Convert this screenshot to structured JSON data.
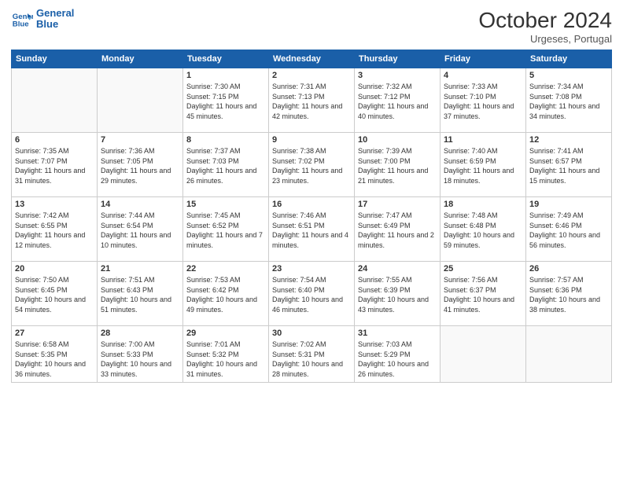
{
  "header": {
    "logo_line1": "General",
    "logo_line2": "Blue",
    "month": "October 2024",
    "location": "Urgeses, Portugal"
  },
  "weekdays": [
    "Sunday",
    "Monday",
    "Tuesday",
    "Wednesday",
    "Thursday",
    "Friday",
    "Saturday"
  ],
  "weeks": [
    [
      {
        "day": "",
        "sunrise": "",
        "sunset": "",
        "daylight": ""
      },
      {
        "day": "",
        "sunrise": "",
        "sunset": "",
        "daylight": ""
      },
      {
        "day": "1",
        "sunrise": "Sunrise: 7:30 AM",
        "sunset": "Sunset: 7:15 PM",
        "daylight": "Daylight: 11 hours and 45 minutes."
      },
      {
        "day": "2",
        "sunrise": "Sunrise: 7:31 AM",
        "sunset": "Sunset: 7:13 PM",
        "daylight": "Daylight: 11 hours and 42 minutes."
      },
      {
        "day": "3",
        "sunrise": "Sunrise: 7:32 AM",
        "sunset": "Sunset: 7:12 PM",
        "daylight": "Daylight: 11 hours and 40 minutes."
      },
      {
        "day": "4",
        "sunrise": "Sunrise: 7:33 AM",
        "sunset": "Sunset: 7:10 PM",
        "daylight": "Daylight: 11 hours and 37 minutes."
      },
      {
        "day": "5",
        "sunrise": "Sunrise: 7:34 AM",
        "sunset": "Sunset: 7:08 PM",
        "daylight": "Daylight: 11 hours and 34 minutes."
      }
    ],
    [
      {
        "day": "6",
        "sunrise": "Sunrise: 7:35 AM",
        "sunset": "Sunset: 7:07 PM",
        "daylight": "Daylight: 11 hours and 31 minutes."
      },
      {
        "day": "7",
        "sunrise": "Sunrise: 7:36 AM",
        "sunset": "Sunset: 7:05 PM",
        "daylight": "Daylight: 11 hours and 29 minutes."
      },
      {
        "day": "8",
        "sunrise": "Sunrise: 7:37 AM",
        "sunset": "Sunset: 7:03 PM",
        "daylight": "Daylight: 11 hours and 26 minutes."
      },
      {
        "day": "9",
        "sunrise": "Sunrise: 7:38 AM",
        "sunset": "Sunset: 7:02 PM",
        "daylight": "Daylight: 11 hours and 23 minutes."
      },
      {
        "day": "10",
        "sunrise": "Sunrise: 7:39 AM",
        "sunset": "Sunset: 7:00 PM",
        "daylight": "Daylight: 11 hours and 21 minutes."
      },
      {
        "day": "11",
        "sunrise": "Sunrise: 7:40 AM",
        "sunset": "Sunset: 6:59 PM",
        "daylight": "Daylight: 11 hours and 18 minutes."
      },
      {
        "day": "12",
        "sunrise": "Sunrise: 7:41 AM",
        "sunset": "Sunset: 6:57 PM",
        "daylight": "Daylight: 11 hours and 15 minutes."
      }
    ],
    [
      {
        "day": "13",
        "sunrise": "Sunrise: 7:42 AM",
        "sunset": "Sunset: 6:55 PM",
        "daylight": "Daylight: 11 hours and 12 minutes."
      },
      {
        "day": "14",
        "sunrise": "Sunrise: 7:44 AM",
        "sunset": "Sunset: 6:54 PM",
        "daylight": "Daylight: 11 hours and 10 minutes."
      },
      {
        "day": "15",
        "sunrise": "Sunrise: 7:45 AM",
        "sunset": "Sunset: 6:52 PM",
        "daylight": "Daylight: 11 hours and 7 minutes."
      },
      {
        "day": "16",
        "sunrise": "Sunrise: 7:46 AM",
        "sunset": "Sunset: 6:51 PM",
        "daylight": "Daylight: 11 hours and 4 minutes."
      },
      {
        "day": "17",
        "sunrise": "Sunrise: 7:47 AM",
        "sunset": "Sunset: 6:49 PM",
        "daylight": "Daylight: 11 hours and 2 minutes."
      },
      {
        "day": "18",
        "sunrise": "Sunrise: 7:48 AM",
        "sunset": "Sunset: 6:48 PM",
        "daylight": "Daylight: 10 hours and 59 minutes."
      },
      {
        "day": "19",
        "sunrise": "Sunrise: 7:49 AM",
        "sunset": "Sunset: 6:46 PM",
        "daylight": "Daylight: 10 hours and 56 minutes."
      }
    ],
    [
      {
        "day": "20",
        "sunrise": "Sunrise: 7:50 AM",
        "sunset": "Sunset: 6:45 PM",
        "daylight": "Daylight: 10 hours and 54 minutes."
      },
      {
        "day": "21",
        "sunrise": "Sunrise: 7:51 AM",
        "sunset": "Sunset: 6:43 PM",
        "daylight": "Daylight: 10 hours and 51 minutes."
      },
      {
        "day": "22",
        "sunrise": "Sunrise: 7:53 AM",
        "sunset": "Sunset: 6:42 PM",
        "daylight": "Daylight: 10 hours and 49 minutes."
      },
      {
        "day": "23",
        "sunrise": "Sunrise: 7:54 AM",
        "sunset": "Sunset: 6:40 PM",
        "daylight": "Daylight: 10 hours and 46 minutes."
      },
      {
        "day": "24",
        "sunrise": "Sunrise: 7:55 AM",
        "sunset": "Sunset: 6:39 PM",
        "daylight": "Daylight: 10 hours and 43 minutes."
      },
      {
        "day": "25",
        "sunrise": "Sunrise: 7:56 AM",
        "sunset": "Sunset: 6:37 PM",
        "daylight": "Daylight: 10 hours and 41 minutes."
      },
      {
        "day": "26",
        "sunrise": "Sunrise: 7:57 AM",
        "sunset": "Sunset: 6:36 PM",
        "daylight": "Daylight: 10 hours and 38 minutes."
      }
    ],
    [
      {
        "day": "27",
        "sunrise": "Sunrise: 6:58 AM",
        "sunset": "Sunset: 5:35 PM",
        "daylight": "Daylight: 10 hours and 36 minutes."
      },
      {
        "day": "28",
        "sunrise": "Sunrise: 7:00 AM",
        "sunset": "Sunset: 5:33 PM",
        "daylight": "Daylight: 10 hours and 33 minutes."
      },
      {
        "day": "29",
        "sunrise": "Sunrise: 7:01 AM",
        "sunset": "Sunset: 5:32 PM",
        "daylight": "Daylight: 10 hours and 31 minutes."
      },
      {
        "day": "30",
        "sunrise": "Sunrise: 7:02 AM",
        "sunset": "Sunset: 5:31 PM",
        "daylight": "Daylight: 10 hours and 28 minutes."
      },
      {
        "day": "31",
        "sunrise": "Sunrise: 7:03 AM",
        "sunset": "Sunset: 5:29 PM",
        "daylight": "Daylight: 10 hours and 26 minutes."
      },
      {
        "day": "",
        "sunrise": "",
        "sunset": "",
        "daylight": ""
      },
      {
        "day": "",
        "sunrise": "",
        "sunset": "",
        "daylight": ""
      }
    ]
  ]
}
